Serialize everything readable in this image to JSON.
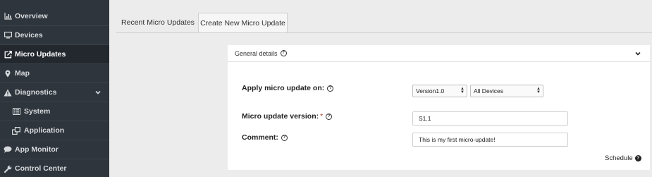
{
  "sidebar": {
    "items": [
      {
        "label": "Overview",
        "icon": "bar-chart-icon"
      },
      {
        "label": "Devices",
        "icon": "monitor-icon"
      },
      {
        "label": "Micro Updates",
        "icon": "external-link-icon",
        "active": true
      },
      {
        "label": "Map",
        "icon": "map-pin-icon"
      },
      {
        "label": "Diagnostics",
        "icon": "warning-icon",
        "expanded": true
      },
      {
        "label": "System",
        "icon": "list-icon"
      },
      {
        "label": "Application",
        "icon": "windows-icon"
      },
      {
        "label": "App Monitor",
        "icon": "speech-bubble-icon"
      },
      {
        "label": "Control Center",
        "icon": "wrench-icon"
      }
    ]
  },
  "tabs": [
    {
      "label": "Recent Micro Updates",
      "active": false
    },
    {
      "label": "Create New Micro Update",
      "active": true
    }
  ],
  "panel": {
    "header": "General details",
    "apply_label": "Apply micro update on:",
    "version_select": "Version1.0",
    "devices_select": "All Devices",
    "version_label": "Micro update version:",
    "required_mark": "*",
    "version_value": "S1.1",
    "comment_label": "Comment:",
    "comment_value": "This is my first micro-update!",
    "schedule_label": "Schedule"
  },
  "colors": {
    "sidebar_bg": "#2f353d",
    "sidebar_active": "#23282e",
    "content_bg": "#ececec",
    "panel_bg": "#ffffff"
  }
}
